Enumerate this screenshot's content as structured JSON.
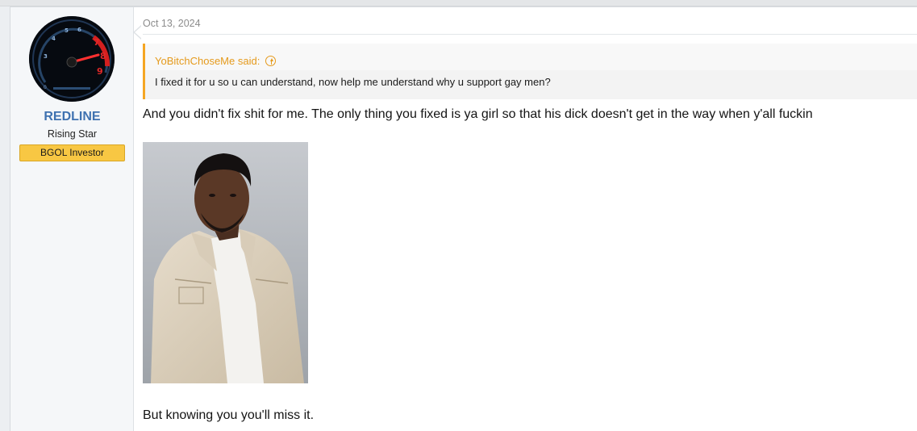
{
  "post": {
    "user": {
      "avatar_icon": "speedometer-avatar",
      "name": "REDLINE",
      "title": "Rising Star",
      "banner": "BGOL Investor",
      "banner_color": "#f8c743",
      "name_color": "#3f72b0"
    },
    "date": "Oct 13, 2024",
    "quote": {
      "author": "YoBitchChoseMe said:",
      "icon": "arrow-up-circle-icon",
      "text": "I fixed it for u so u can understand, now help me understand why u support gay men?",
      "accent_color": "#f5a623"
    },
    "body_text": "And you didn't fix shit for me. The only thing you fixed is ya girl so that his dick doesn't get in the way when y'all fuckin",
    "image_description_icon": "man-in-denim-jacket-photo",
    "body_text_after": "But knowing you you'll miss it."
  }
}
